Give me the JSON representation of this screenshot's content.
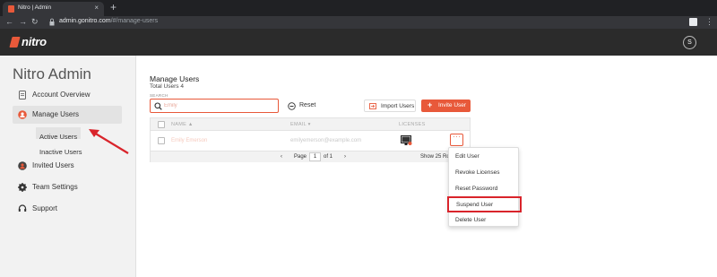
{
  "browser": {
    "tab_title": "Nitro | Admin",
    "tab_close": "×",
    "new_tab": "+",
    "url_host": "admin.gonitro.com",
    "url_path": "/#/manage-users"
  },
  "appbar": {
    "logo_text": "nitro",
    "avatar_letter": "S"
  },
  "sidebar": {
    "brand": "Nitro Admin",
    "items": [
      {
        "label": "Account Overview",
        "icon": "document-icon"
      },
      {
        "label": "Manage Users",
        "icon": "users-icon"
      },
      {
        "label": "Invited Users",
        "icon": "user-icon"
      },
      {
        "label": "Team Settings",
        "icon": "gear-icon"
      },
      {
        "label": "Support",
        "icon": "headset-icon"
      }
    ],
    "sub_items": [
      {
        "label": "Active Users"
      },
      {
        "label": "Inactive Users"
      }
    ]
  },
  "main": {
    "title": "Manage Users",
    "subtitle": "Total Users 4",
    "search_label": "SEARCH",
    "search_placeholder": "Emily",
    "reset_label": "Reset",
    "import_label": "Import Users",
    "invite_label": "Invite User",
    "invite_icon": "+"
  },
  "table": {
    "headers": {
      "name": "NAME ▲",
      "email": "EMAIL ▾",
      "licenses": "LICENSES"
    },
    "rows": [
      {
        "name": "Emily Emerson",
        "email": "emilyemerson@example.com"
      }
    ],
    "more": "···",
    "pager": {
      "prev": "‹",
      "page_label": "Page",
      "page_value": "1",
      "of": "of 1",
      "next": "›",
      "show": "Show 25 Ro"
    }
  },
  "menu": {
    "items": [
      {
        "label": "Edit User"
      },
      {
        "label": "Revoke Licenses"
      },
      {
        "label": "Reset Password"
      },
      {
        "label": "Suspend User"
      },
      {
        "label": "Delete User"
      }
    ]
  },
  "colors": {
    "accent": "#e8593a",
    "highlight": "#d9242b",
    "appbar": "#2b2b2b"
  }
}
